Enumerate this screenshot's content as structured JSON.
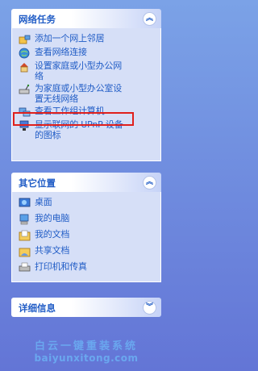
{
  "network_tasks": {
    "title": "网络任务",
    "items": [
      {
        "label": "添加一个网上邻居",
        "icon": "add-network-place-icon"
      },
      {
        "label": "查看网络连接",
        "icon": "network-connections-icon"
      },
      {
        "label": "设置家庭或小型办公网\n络",
        "icon": "home-network-setup-icon"
      },
      {
        "label": "为家庭或小型办公室设\n置无线网络",
        "icon": "wireless-network-setup-icon"
      },
      {
        "label": "查看工作组计算机",
        "icon": "workgroup-computers-icon"
      },
      {
        "label": "显示联网的 UPnP 设备\n的图标",
        "icon": "upnp-devices-icon"
      }
    ]
  },
  "other_places": {
    "title": "其它位置",
    "items": [
      {
        "label": "桌面",
        "icon": "desktop-icon"
      },
      {
        "label": "我的电脑",
        "icon": "my-computer-icon"
      },
      {
        "label": "我的文档",
        "icon": "my-documents-icon"
      },
      {
        "label": "共享文档",
        "icon": "shared-documents-icon"
      },
      {
        "label": "打印机和传真",
        "icon": "printers-faxes-icon"
      }
    ]
  },
  "details": {
    "title": "详细信息"
  },
  "watermark": {
    "line1": "白云一键重装系统",
    "line2": "baiyunxitong.com"
  },
  "colors": {
    "link": "#215dc6",
    "highlight_border": "#e0201c",
    "panel_bg": "#d6dff7"
  }
}
